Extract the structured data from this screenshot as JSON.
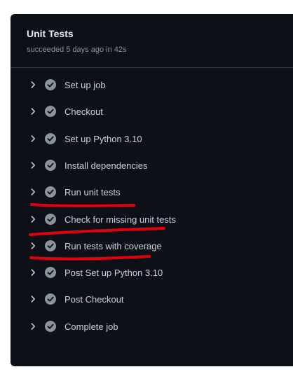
{
  "job": {
    "title": "Unit Tests",
    "status_text": "succeeded 5 days ago in 42s"
  },
  "steps": [
    {
      "label": "Set up job",
      "status": "success"
    },
    {
      "label": "Checkout",
      "status": "success"
    },
    {
      "label": "Set up Python 3.10",
      "status": "success"
    },
    {
      "label": "Install dependencies",
      "status": "success"
    },
    {
      "label": "Run unit tests",
      "status": "success"
    },
    {
      "label": "Check for missing unit tests",
      "status": "success"
    },
    {
      "label": "Run tests with coverage",
      "status": "success"
    },
    {
      "label": "Post Set up Python 3.10",
      "status": "success"
    },
    {
      "label": "Post Checkout",
      "status": "success"
    },
    {
      "label": "Complete job",
      "status": "success"
    }
  ],
  "icons": {
    "expand": "chevron-right-icon",
    "status": "check-circle-icon"
  },
  "annotation": {
    "color": "#e0000f"
  }
}
